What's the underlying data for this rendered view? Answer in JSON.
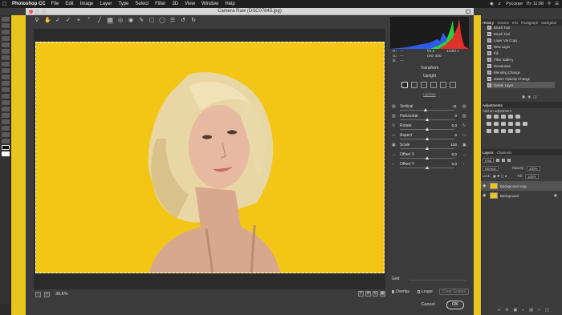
{
  "menubar": {
    "app_name": "Photoshop CC",
    "items": [
      "File",
      "Edit",
      "Image",
      "Layer",
      "Type",
      "Select",
      "Filter",
      "3D",
      "View",
      "Window",
      "Help"
    ],
    "tray": {
      "language": "Русская",
      "clock": "Пт 11:08"
    }
  },
  "camera_raw": {
    "title": "Camera Raw (DSC07845.jpg)",
    "zoom": "39,6%",
    "camera_info": {
      "line1_left": "---",
      "line1_mid": "f/2,2",
      "line1_right": "1/250 с",
      "line2_left": "---",
      "line2_mid": "ISO 400",
      "line3_left": "---"
    },
    "panel_title": "Transform",
    "upright_label": "Upright",
    "update_label": "Update",
    "sliders": [
      {
        "label": "Vertical",
        "value": "-11",
        "fraction": 0.47,
        "icon": "vertical-perspective-icon"
      },
      {
        "label": "Horizontal",
        "value": "0",
        "fraction": 0.5,
        "icon": "horizontal-perspective-icon"
      },
      {
        "label": "Rotate",
        "value": "0,0",
        "fraction": 0.5,
        "icon": "rotate-icon"
      },
      {
        "label": "Aspect",
        "value": "0",
        "fraction": 0.5,
        "icon": "aspect-icon"
      },
      {
        "label": "Scale",
        "value": "100",
        "fraction": 0.5,
        "icon": "scale-icon"
      },
      {
        "label": "Offset X",
        "value": "0,0",
        "fraction": 0.5,
        "icon": "offset-x-icon"
      },
      {
        "label": "Offset Y",
        "value": "0,0",
        "fraction": 0.5,
        "icon": "offset-y-icon"
      }
    ],
    "grid_label": "Grid",
    "overlay_label": "Overlay",
    "loupe_label": "Loupe",
    "clear_guides_label": "Clear Guides",
    "cancel_label": "Cancel",
    "ok_label": "OK"
  },
  "ps_panels": {
    "history_tabs": [
      "History",
      "Actions",
      "Info",
      "Paragraph",
      "Navigator"
    ],
    "history_items": [
      "Brush Tool",
      "Brush Tool",
      "Layer Via Copy",
      "New Layer",
      "Fill",
      "Filter Gallery",
      "Desaturate",
      "Blending Change",
      "Master Opacity Change",
      "Delete Layer"
    ],
    "adjustments_title": "Adjustments",
    "add_adjustment_label": "Add an adjustment",
    "layers_tabs": [
      "Layers",
      "Channels"
    ],
    "kind_label": "Kind",
    "blend_mode": "Normal",
    "opacity_label": "Opacity:",
    "opacity_value": "100%",
    "lock_label": "Lock:",
    "fill_label": "Fill:",
    "fill_value": "100%",
    "layers": [
      {
        "name": "Background copy",
        "selected": true
      },
      {
        "name": "Background",
        "selected": false
      }
    ]
  },
  "histogram_colors": {
    "red": "#e0302a",
    "green": "#2ecf3b",
    "blue": "#2d5de8"
  }
}
